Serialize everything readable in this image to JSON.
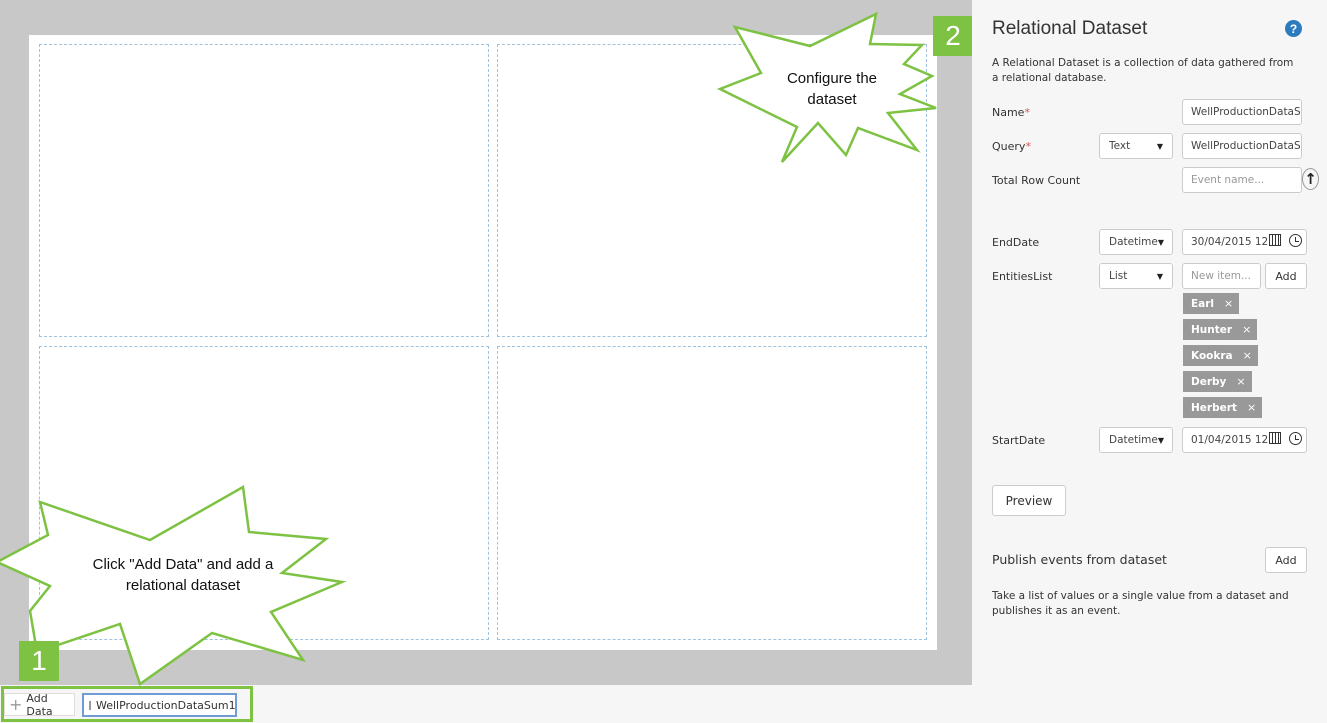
{
  "canvas": {
    "add_data_label": "Add Data",
    "dataset_chip_label": "WellProductionDataSum1"
  },
  "steps": {
    "step1": "1",
    "step2": "2",
    "callout1": "Click \"Add Data\" and add a relational dataset",
    "callout2": "Configure the dataset"
  },
  "panel": {
    "title": "Relational Dataset",
    "help": "?",
    "description": "A Relational Dataset is a collection of data gathered from a relational database.",
    "name_label": "Name",
    "name_value": "WellProductionDataS",
    "query_label": "Query",
    "query_type": "Text",
    "query_value": "WellProductionDataS",
    "row_count_label": "Total Row Count",
    "row_count_placeholder": "Event name...",
    "enddate_label": "EndDate",
    "enddate_type": "Datetime",
    "enddate_value": "30/04/2015 12",
    "entities_label": "EntitiesList",
    "entities_type": "List",
    "entities_placeholder": "New item...",
    "entities_add": "Add",
    "entities": [
      "Earl",
      "Hunter",
      "Kookra",
      "Derby",
      "Herbert"
    ],
    "startdate_label": "StartDate",
    "startdate_type": "Datetime",
    "startdate_value": "01/04/2015 12",
    "preview_label": "Preview",
    "publish_heading": "Publish events from dataset",
    "publish_add": "Add",
    "publish_description": "Take a list of values or a single value from a dataset and publishes it as an event.",
    "required_mark": "*",
    "tag_remove": "×"
  }
}
